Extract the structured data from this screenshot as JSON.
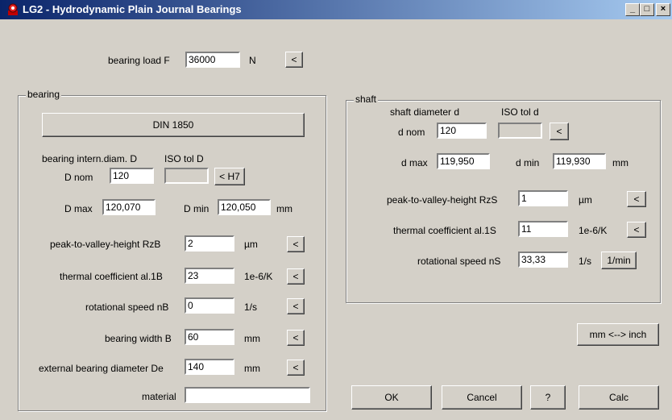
{
  "window": {
    "title": "LG2 - Hydrodynamic Plain Journal Bearings",
    "minimize": "_",
    "maximize": "□",
    "close": "×"
  },
  "load": {
    "label": "bearing load F",
    "value": "36000",
    "unit": "N",
    "button": "<"
  },
  "bearing": {
    "group_title": "bearing",
    "din_button": "DIN 1850",
    "diam_label": "bearing intern.diam. D",
    "iso_label": "ISO tol D",
    "dnom_label": "D nom",
    "dnom_value": "120",
    "iso_button": "< H7",
    "dmax_label": "D max",
    "dmax_value": "120,070",
    "dmin_label": "D min",
    "dmin_value": "120,050",
    "mm": "mm",
    "rz_label": "peak-to-valley-height RzB",
    "rz_value": "2",
    "rz_unit": "µm",
    "al_label": "thermal coefficient al.1B",
    "al_value": "23",
    "al_unit": "1e-6/K",
    "n_label": "rotational speed nB",
    "n_value": "0",
    "n_unit": "1/s",
    "b_label": "bearing width B",
    "b_value": "60",
    "b_unit": "mm",
    "de_label": "external bearing diameter De",
    "de_value": "140",
    "de_unit": "mm",
    "material_label": "material",
    "material_value": "",
    "arrow": "<"
  },
  "shaft": {
    "group_title": "shaft",
    "diam_label": "shaft diameter d",
    "iso_label": "ISO tol d",
    "dnom_label": "d nom",
    "dnom_value": "120",
    "dmax_label": "d max",
    "dmax_value": "119,950",
    "dmin_label": "d min",
    "dmin_value": "119,930",
    "mm": "mm",
    "rz_label": "peak-to-valley-height RzS",
    "rz_value": "1",
    "rz_unit": "µm",
    "al_label": "thermal coefficient al.1S",
    "al_value": "11",
    "al_unit": "1e-6/K",
    "n_label": "rotational speed nS",
    "n_value": "33,33",
    "n_unit": "1/s",
    "n_button": "1/min",
    "arrow": "<"
  },
  "buttons": {
    "unit_toggle": "mm <--> inch",
    "ok": "OK",
    "cancel": "Cancel",
    "help": "?",
    "calc": "Calc"
  },
  "colors": {
    "title_start": "#0a246a",
    "title_end": "#a6caf0",
    "face": "#d4d0c8"
  }
}
